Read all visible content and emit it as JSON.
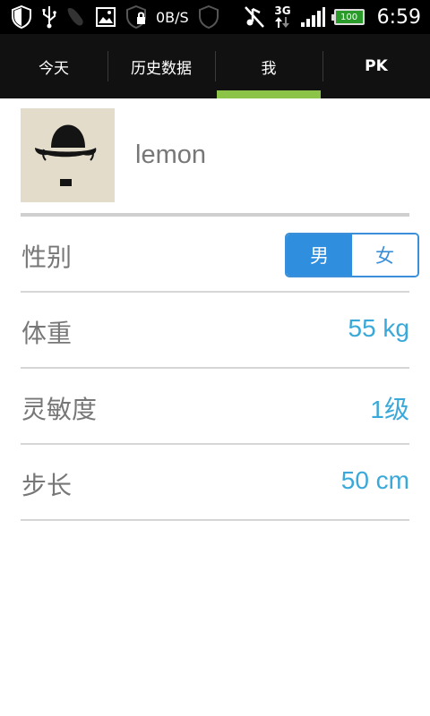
{
  "status_bar": {
    "net_speed": "0B/S",
    "network_type": "3G",
    "battery": "100",
    "time": "6:59",
    "icons_left": [
      "shield-icon",
      "usb-icon",
      "footprint-icon",
      "image-icon",
      "shield-lock-icon",
      "shield-icon"
    ],
    "icons_right": [
      "music-off-icon",
      "data-3g-icon",
      "signal-icon",
      "battery-icon"
    ]
  },
  "tabs": [
    {
      "label": "今天"
    },
    {
      "label": "历史数据"
    },
    {
      "label": "我"
    },
    {
      "label": "PK"
    }
  ],
  "active_tab": "我",
  "profile": {
    "username": "lemon",
    "avatar": "bowler-hat-mustache-avatar"
  },
  "settings": {
    "gender": {
      "label": "性别",
      "male": "男",
      "female": "女",
      "selected": "男"
    },
    "weight": {
      "label": "体重",
      "value": "55 kg"
    },
    "sensitivity": {
      "label": "灵敏度",
      "value": "1级"
    },
    "stride": {
      "label": "步长",
      "value": "50 cm"
    }
  },
  "colors": {
    "accent_green": "#8cc447",
    "value_blue": "#3aa9d9",
    "toggle_blue": "#2f8fde"
  }
}
